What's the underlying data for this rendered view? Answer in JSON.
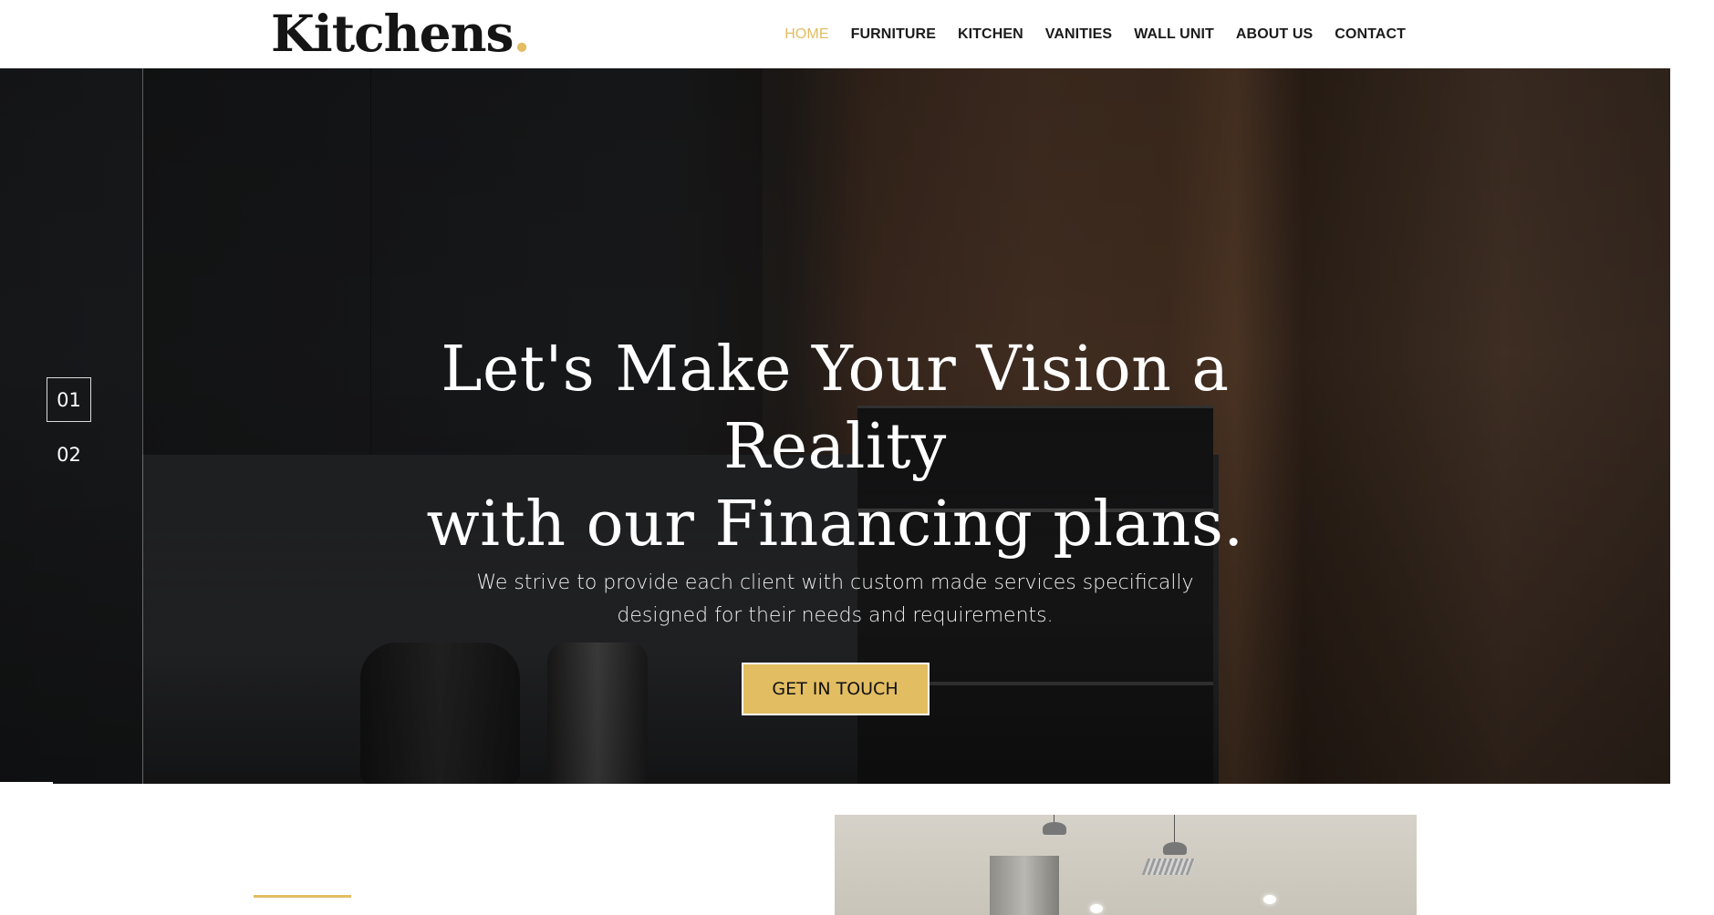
{
  "header": {
    "logo_text": "Kitchens",
    "logo_dot": ".",
    "nav": [
      {
        "label": "HOME",
        "active": true
      },
      {
        "label": "FURNITURE",
        "active": false
      },
      {
        "label": "KITCHEN",
        "active": false
      },
      {
        "label": "VANITIES",
        "active": false
      },
      {
        "label": "WALL UNIT",
        "active": false
      },
      {
        "label": "ABOUT US",
        "active": false
      },
      {
        "label": "CONTACT",
        "active": false
      }
    ]
  },
  "hero": {
    "title_line1": "Let's Make Your Vision a Reality",
    "title_line2": "with our Financing plans.",
    "subtitle_line1": "We strive to provide each client with custom made services specifically",
    "subtitle_line2": "designed for their needs and requirements.",
    "cta_label": "GET IN TOUCH",
    "slides": [
      "01",
      "02"
    ],
    "active_slide": "01"
  },
  "colors": {
    "accent": "#e2bd62",
    "nav_text": "#1b1b1b",
    "logo_text": "#151515"
  }
}
